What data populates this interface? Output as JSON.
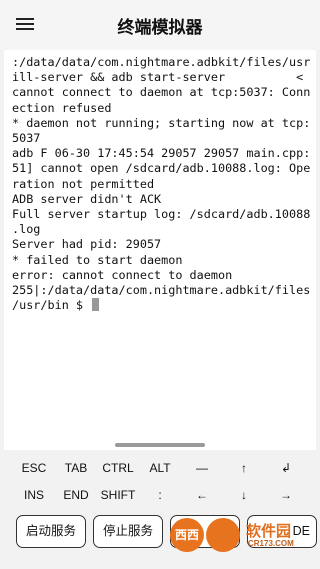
{
  "app_bar": {
    "title": "终端模拟器",
    "menu_icon": "hamburger-menu-icon"
  },
  "terminal": {
    "lines": [
      ":/data/data/com.nightmare.adbkit/files/usr",
      "ill-server && adb start-server          <",
      "cannot connect to daemon at tcp:5037: Conn",
      "ection refused",
      "* daemon not running; starting now at tcp:",
      "5037",
      "adb F 06-30 17:45:54 29057 29057 main.cpp:",
      "51] cannot open /sdcard/adb.10088.log: Ope",
      "ration not permitted",
      "ADB server didn't ACK",
      "Full server startup log: /sdcard/adb.10088",
      ".log",
      "Server had pid: 29057",
      "* failed to start daemon",
      "error: cannot connect to daemon",
      "255|:/data/data/com.nightmare.adbkit/files",
      "/usr/bin $ "
    ]
  },
  "extra_keys": {
    "row1": [
      "ESC",
      "TAB",
      "CTRL",
      "ALT",
      "—",
      "↑",
      "↲"
    ],
    "row2": [
      "INS",
      "END",
      "SHIFT",
      ":",
      "←",
      "↓",
      "→"
    ]
  },
  "actions": {
    "start_service": "启动服务",
    "stop_service": "停止服务",
    "third_partial": "DE"
  },
  "watermark": {
    "logo_text": "西西",
    "brand": "软件园",
    "url": "CR173.COM"
  }
}
